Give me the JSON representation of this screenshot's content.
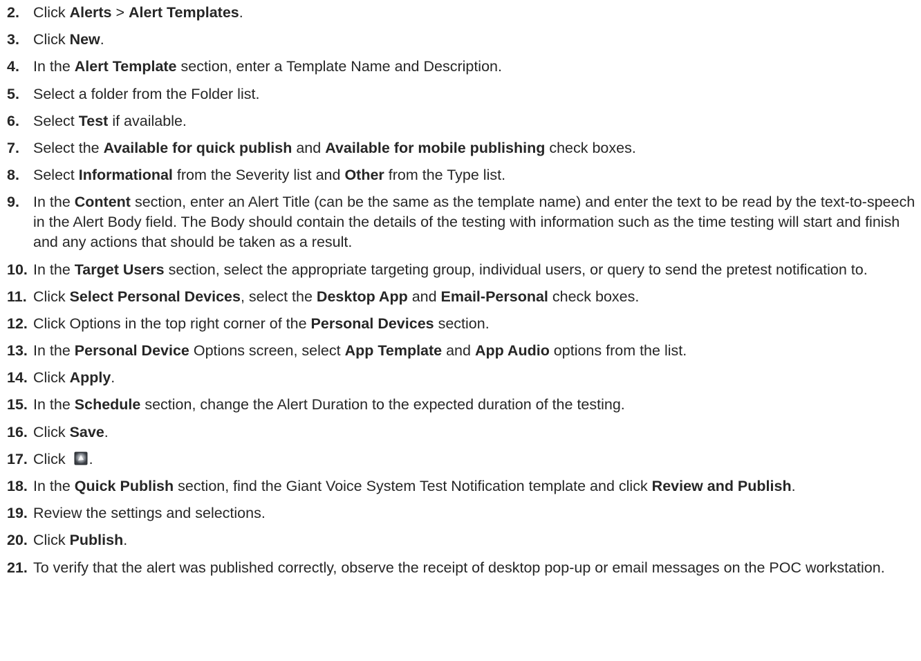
{
  "steps": [
    {
      "num": "2.",
      "parts": [
        [
          "Click ",
          0
        ],
        [
          "Alerts",
          1
        ],
        [
          " > ",
          0
        ],
        [
          "Alert Templates",
          1
        ],
        [
          ".",
          0
        ]
      ]
    },
    {
      "num": "3.",
      "parts": [
        [
          "Click ",
          0
        ],
        [
          "New",
          1
        ],
        [
          ".",
          0
        ]
      ]
    },
    {
      "num": "4.",
      "parts": [
        [
          "In the ",
          0
        ],
        [
          "Alert Template",
          1
        ],
        [
          " section, enter a Template Name and Description.",
          0
        ]
      ]
    },
    {
      "num": "5.",
      "parts": [
        [
          "Select a folder from the Folder list.",
          0
        ]
      ]
    },
    {
      "num": "6.",
      "parts": [
        [
          "Select ",
          0
        ],
        [
          "Test",
          1
        ],
        [
          " if available.",
          0
        ]
      ]
    },
    {
      "num": "7.",
      "parts": [
        [
          "Select the ",
          0
        ],
        [
          "Available for quick publish",
          1
        ],
        [
          " and ",
          0
        ],
        [
          "Available for mobile publishing",
          1
        ],
        [
          " check boxes.",
          0
        ]
      ]
    },
    {
      "num": "8.",
      "parts": [
        [
          "Select ",
          0
        ],
        [
          "Informational",
          1
        ],
        [
          " from the Severity list and ",
          0
        ],
        [
          "Other",
          1
        ],
        [
          " from the Type list.",
          0
        ]
      ]
    },
    {
      "num": "9.",
      "parts": [
        [
          "In the ",
          0
        ],
        [
          "Content",
          1
        ],
        [
          " section, enter an Alert Title (can be the same as the template name) and enter the text to be read by the text-to-speech in the Alert Body field. The Body should contain the details of the testing with information such as the time testing will start and finish and any actions that should be taken as a result.",
          0
        ]
      ]
    },
    {
      "num": "10.",
      "parts": [
        [
          "In the ",
          0
        ],
        [
          "Target Users",
          1
        ],
        [
          " section, select the appropriate targeting group, individual users, or query to send the pretest notification to.",
          0
        ]
      ]
    },
    {
      "num": "11.",
      "parts": [
        [
          "Click ",
          0
        ],
        [
          "Select Personal Devices",
          1
        ],
        [
          ", select the ",
          0
        ],
        [
          "Desktop App",
          1
        ],
        [
          " and ",
          0
        ],
        [
          "Email-Personal",
          1
        ],
        [
          " check boxes.",
          0
        ]
      ]
    },
    {
      "num": "12.",
      "parts": [
        [
          "Click Options in the top right corner of the ",
          0
        ],
        [
          "Personal Devices",
          1
        ],
        [
          " section.",
          0
        ]
      ]
    },
    {
      "num": "13.",
      "parts": [
        [
          "In the ",
          0
        ],
        [
          "Personal Device",
          1
        ],
        [
          " Options screen, select ",
          0
        ],
        [
          "App Template",
          1
        ],
        [
          " and ",
          0
        ],
        [
          "App Audio",
          1
        ],
        [
          " options from the list.",
          0
        ]
      ]
    },
    {
      "num": "14.",
      "parts": [
        [
          "Click ",
          0
        ],
        [
          "Apply",
          1
        ],
        [
          ".",
          0
        ]
      ]
    },
    {
      "num": "15.",
      "parts": [
        [
          "In the ",
          0
        ],
        [
          "Schedule",
          1
        ],
        [
          " section, change the Alert Duration to the expected duration of the testing.",
          0
        ]
      ]
    },
    {
      "num": "16.",
      "parts": [
        [
          "Click ",
          0
        ],
        [
          "Save",
          1
        ],
        [
          ".",
          0
        ]
      ]
    },
    {
      "num": "17.",
      "parts": [
        [
          "Click ",
          0
        ],
        [
          "__ICON__",
          2
        ],
        [
          ".",
          0
        ]
      ]
    },
    {
      "num": "18.",
      "parts": [
        [
          "In the ",
          0
        ],
        [
          "Quick Publish",
          1
        ],
        [
          " section, find the Giant Voice System Test Notification template and click ",
          0
        ],
        [
          "Review and Publish",
          1
        ],
        [
          ".",
          0
        ]
      ]
    },
    {
      "num": "19.",
      "parts": [
        [
          "Review the settings and selections.",
          0
        ]
      ]
    },
    {
      "num": "20.",
      "parts": [
        [
          "Click ",
          0
        ],
        [
          "Publish",
          1
        ],
        [
          ".",
          0
        ]
      ]
    },
    {
      "num": "21.",
      "parts": [
        [
          "To verify that the alert was published correctly, observe the receipt of desktop pop-up or email messages on the POC workstation.",
          0
        ]
      ]
    }
  ],
  "icons": {
    "step17": "quick-publish-icon"
  }
}
